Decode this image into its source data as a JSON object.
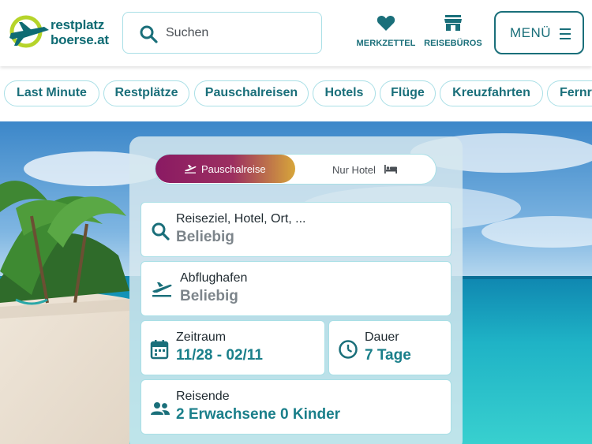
{
  "header": {
    "logo": {
      "line1": "restplatz",
      "line2": "boerse.at"
    },
    "search_placeholder": "Suchen",
    "nav": [
      {
        "label": "MERKZETTEL",
        "icon": "heart-icon"
      },
      {
        "label": "REISEBÜROS",
        "icon": "store-icon"
      }
    ],
    "menu_label": "MENÜ"
  },
  "pills": [
    "Last Minute",
    "Restplätze",
    "Pauschalreisen",
    "Hotels",
    "Flüge",
    "Kreuzfahrten",
    "Fernr"
  ],
  "form": {
    "tabs": [
      {
        "label": "Pauschalreise",
        "active": true,
        "icon": "plane-departure-icon"
      },
      {
        "label": "Nur Hotel",
        "active": false,
        "icon": "bed-icon"
      }
    ],
    "destination": {
      "label": "Reiseziel, Hotel, Ort, ...",
      "value": "Beliebig",
      "icon": "search-icon"
    },
    "airport": {
      "label": "Abflughafen",
      "value": "Beliebig",
      "icon": "plane-departure-icon"
    },
    "period": {
      "label": "Zeitraum",
      "value": "11/28 - 02/11",
      "icon": "calendar-icon"
    },
    "duration": {
      "label": "Dauer",
      "value": "7 Tage",
      "icon": "clock-icon"
    },
    "travelers": {
      "label": "Reisende",
      "value": "2 Erwachsene 0 Kinder",
      "icon": "people-icon"
    }
  },
  "colors": {
    "brand_teal": "#1a6f7a",
    "accent_border": "#a9dfe6",
    "logo_green": "#b6d42a",
    "active_tab_gradient": [
      "#8a1a63",
      "#d7a63a"
    ]
  }
}
